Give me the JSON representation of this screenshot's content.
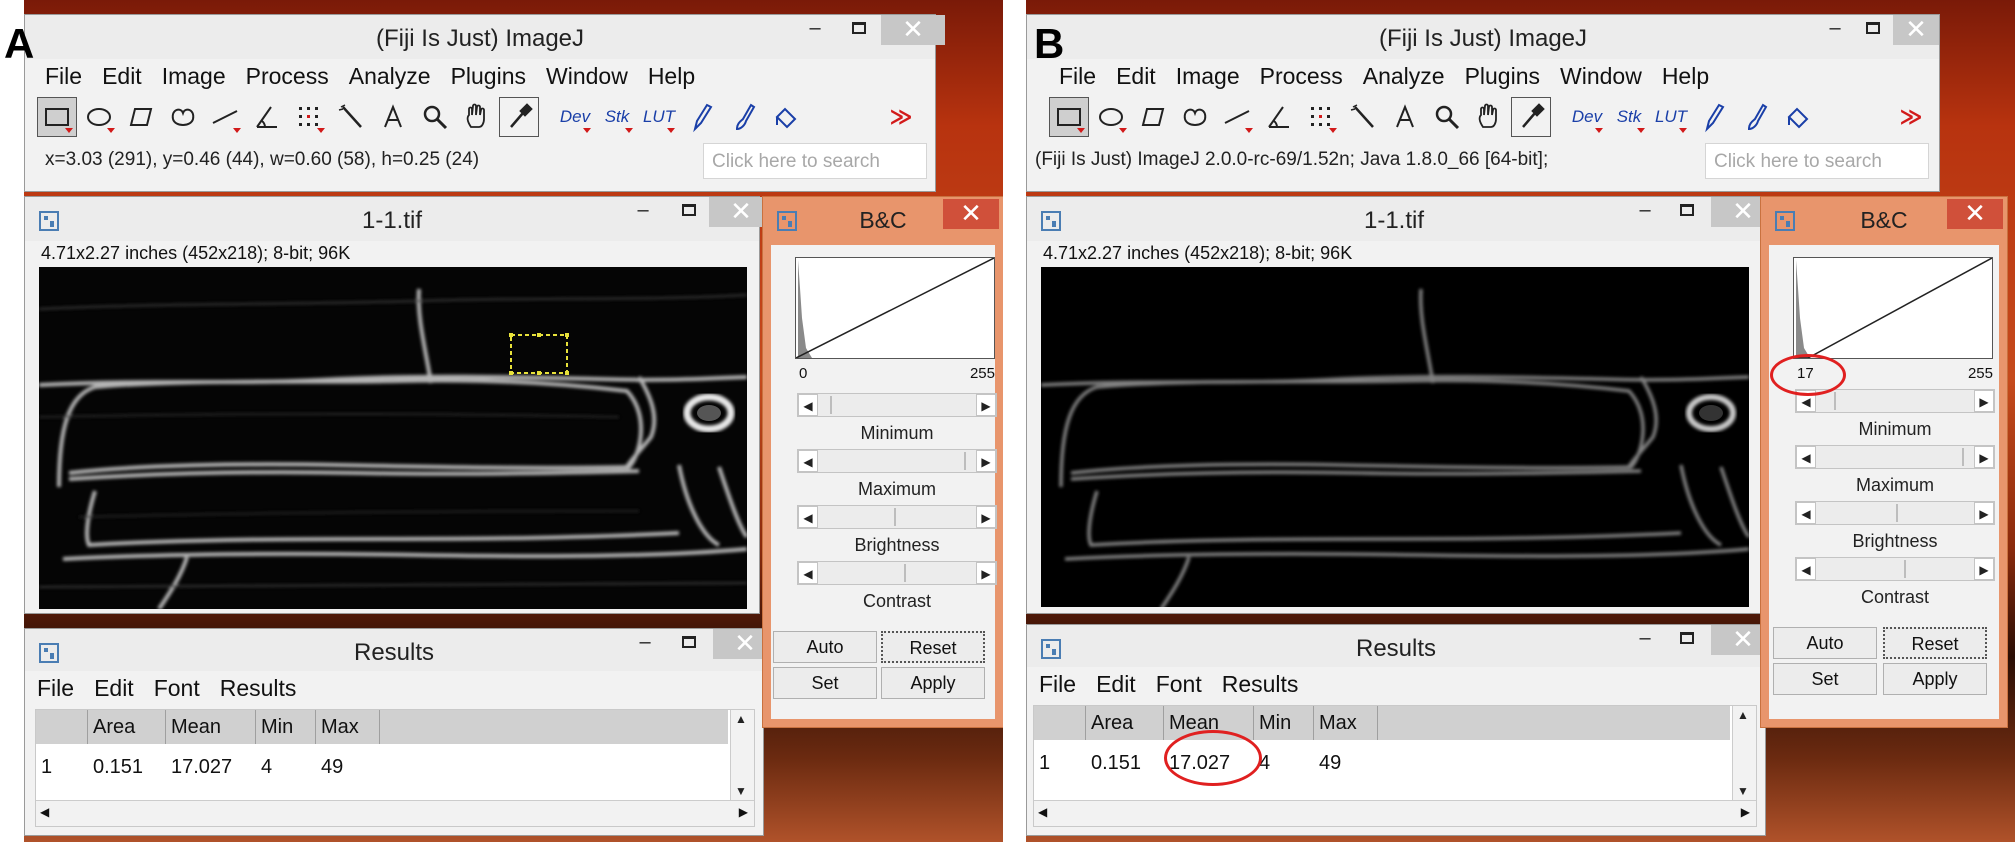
{
  "panels": [
    {
      "letter": "A",
      "imagej": {
        "title": "(Fiji Is Just) ImageJ",
        "menu": [
          "File",
          "Edit",
          "Image",
          "Process",
          "Analyze",
          "Plugins",
          "Window",
          "Help"
        ],
        "tools": [
          "rectangle-icon",
          "oval-icon",
          "polygon-icon",
          "freehand-icon",
          "line-icon",
          "angle-icon",
          "multipoint-icon",
          "wand-icon",
          "text-icon",
          "magnifier-icon",
          "hand-icon",
          "color-picker-icon",
          "Dev",
          "Stk",
          "LUT",
          "pencil-icon",
          "brush-icon",
          "flood-fill-icon",
          "more-tools-icon"
        ],
        "status": "x=3.03 (291), y=0.46 (44), w=0.60 (58), h=0.25 (24)",
        "search_placeholder": "Click here to search",
        "more_tools": "≫"
      },
      "image_window": {
        "title": "1-1.tif",
        "info": "4.71x2.27 inches (452x218); 8-bit; 96K",
        "roi_selected": true
      },
      "bc": {
        "title": "B&C",
        "hist_min": "0",
        "hist_max": "255",
        "min_label": "Minimum",
        "max_label": "Maximum",
        "brightness_label": "Brightness",
        "contrast_label": "Contrast",
        "auto": "Auto",
        "reset": "Reset",
        "set": "Set",
        "apply": "Apply"
      },
      "results": {
        "title": "Results",
        "menu": [
          "File",
          "Edit",
          "Font",
          "Results"
        ],
        "columns": [
          "",
          "Area",
          "Mean",
          "Min",
          "Max"
        ],
        "rows": [
          [
            "1",
            "0.151",
            "17.027",
            "4",
            "49"
          ]
        ]
      }
    },
    {
      "letter": "B",
      "imagej": {
        "title": "(Fiji Is Just) ImageJ",
        "menu": [
          "File",
          "Edit",
          "Image",
          "Process",
          "Analyze",
          "Plugins",
          "Window",
          "Help"
        ],
        "tools": [
          "rectangle-icon",
          "oval-icon",
          "polygon-icon",
          "freehand-icon",
          "line-icon",
          "angle-icon",
          "multipoint-icon",
          "wand-icon",
          "text-icon",
          "magnifier-icon",
          "hand-icon",
          "color-picker-icon",
          "Dev",
          "Stk",
          "LUT",
          "pencil-icon",
          "brush-icon",
          "flood-fill-icon",
          "more-tools-icon"
        ],
        "status": "(Fiji Is Just) ImageJ 2.0.0-rc-69/1.52n; Java 1.8.0_66 [64-bit];",
        "search_placeholder": "Click here to search",
        "more_tools": "≫"
      },
      "image_window": {
        "title": "1-1.tif",
        "info": "4.71x2.27 inches (452x218); 8-bit; 96K",
        "roi_selected": false
      },
      "bc": {
        "title": "B&C",
        "hist_min": "17",
        "hist_max": "255",
        "min_label": "Minimum",
        "max_label": "Maximum",
        "brightness_label": "Brightness",
        "contrast_label": "Contrast",
        "auto": "Auto",
        "reset": "Reset",
        "set": "Set",
        "apply": "Apply"
      },
      "results": {
        "title": "Results",
        "menu": [
          "File",
          "Edit",
          "Font",
          "Results"
        ],
        "columns": [
          "",
          "Area",
          "Mean",
          "Min",
          "Max"
        ],
        "rows": [
          [
            "1",
            "0.151",
            "17.027",
            "4",
            "49"
          ]
        ]
      }
    }
  ],
  "win_controls": {
    "minimize": "–",
    "close": "✕"
  },
  "colors": {
    "bc_frame": "#e8956c",
    "highlight": "#e02020",
    "roi": "#e8e23a",
    "title_bar": "#ececec"
  }
}
